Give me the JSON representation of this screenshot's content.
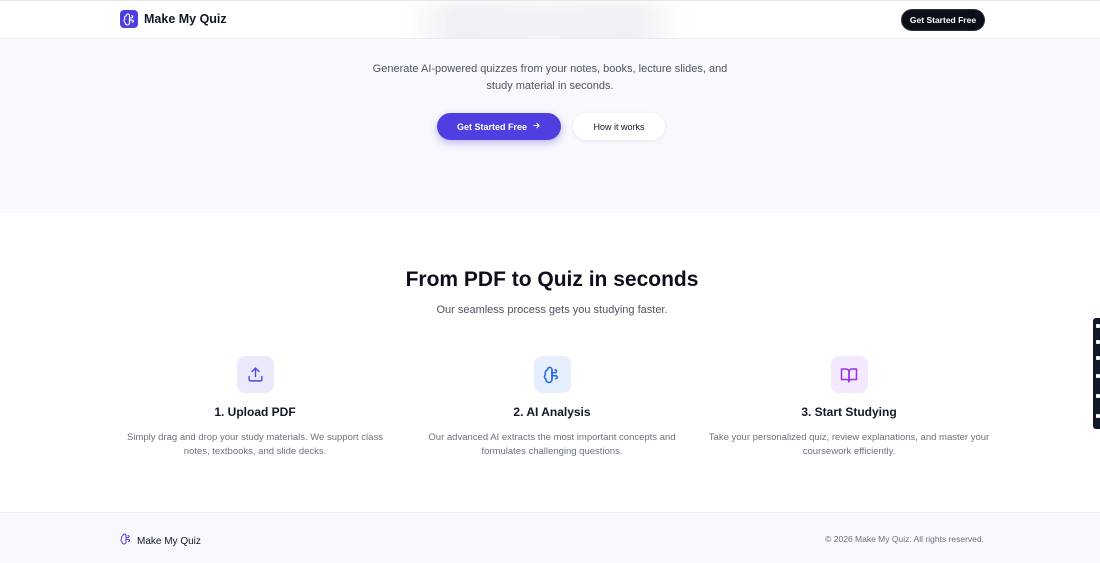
{
  "nav": {
    "brand_name": "Make My Quiz",
    "cta_label": "Get Started Free"
  },
  "hero": {
    "subtitle": "Generate AI-powered quizzes from your notes, books, lecture slides, and study material in seconds.",
    "primary_cta": "Get Started Free",
    "primary_cta_icon": "arrow-right-icon",
    "secondary_cta": "How it works"
  },
  "process": {
    "title": "From PDF to Quiz in seconds",
    "subtitle": "Our seamless process gets you studying faster.",
    "steps": [
      {
        "title": "1. Upload PDF",
        "description": "Simply drag and drop your study materials. We support class notes, textbooks, and slide decks.",
        "icon": "upload-icon",
        "accent": "#4f46e5",
        "bg": "#ebeafd"
      },
      {
        "title": "2. AI Analysis",
        "description": "Our advanced AI extracts the most important concepts and formulates challenging questions.",
        "icon": "brain-icon",
        "accent": "#2563eb",
        "bg": "#e6effd"
      },
      {
        "title": "3. Start Studying",
        "description": "Take your personalized quiz, review explanations, and master your coursework efficiently.",
        "icon": "book-open-icon",
        "accent": "#9333ea",
        "bg": "#f3e8fd"
      }
    ]
  },
  "footer": {
    "brand_name": "Make My Quiz",
    "copyright": "© 2026 Make My Quiz. All rights reserved."
  },
  "colors": {
    "primary": "#4f3fe0",
    "dark": "#0b0f1a",
    "hero_bg": "#f8f8fd"
  }
}
